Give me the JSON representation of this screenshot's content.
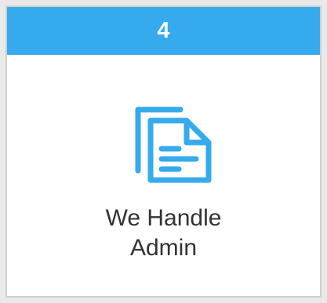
{
  "step": {
    "number": "4",
    "title": "We Handle\nAdmin",
    "icon": "document-copy-icon"
  },
  "colors": {
    "header": "#35aaec",
    "icon": "#35aaec",
    "title_text": "#333333",
    "card_border": "#cfcfcf",
    "page_background": "#e9e9e9"
  }
}
